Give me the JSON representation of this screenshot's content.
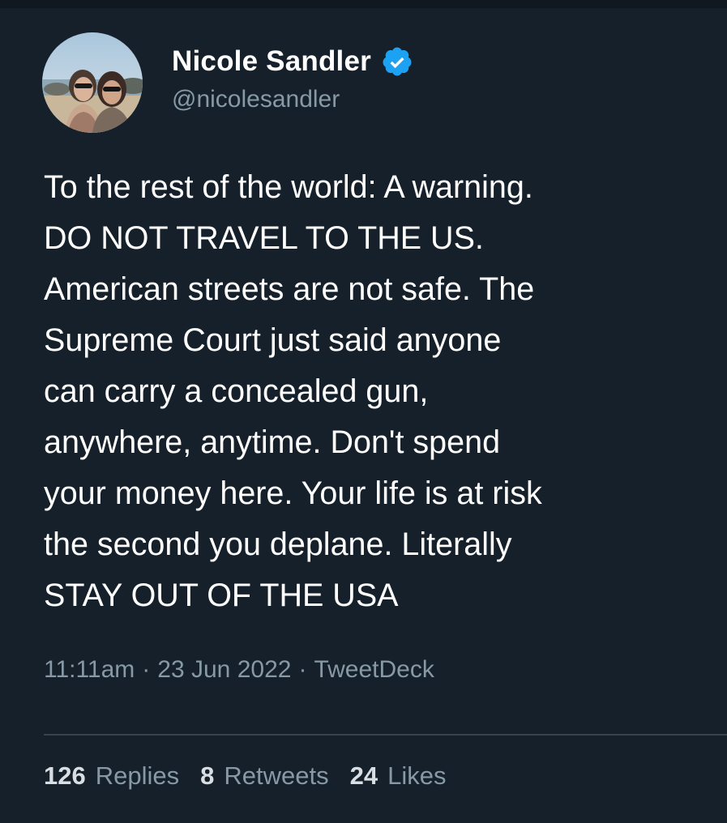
{
  "tweet": {
    "author": {
      "display_name": "Nicole Sandler",
      "handle": "@nicolesandler",
      "verified_icon": "verified-badge-icon"
    },
    "text": "To the rest of the world: A warning.\nDO NOT TRAVEL TO THE US.\nAmerican streets are not safe. The\nSupreme Court just said anyone\ncan carry a concealed gun,\nanywhere, anytime. Don't spend\nyour money here. Your life is at risk\nthe second you deplane. Literally\nSTAY OUT OF THE USA",
    "meta": {
      "time": "11:11am",
      "separator": "·",
      "date": "23 Jun 2022",
      "source": "TweetDeck"
    },
    "stats": {
      "replies_count": "126",
      "replies_label": "Replies",
      "retweets_count": "8",
      "retweets_label": "Retweets",
      "likes_count": "24",
      "likes_label": "Likes"
    }
  },
  "colors": {
    "background": "#15202b",
    "text_primary": "#ffffff",
    "text_secondary": "#8899a6",
    "verified_blue": "#1da1f2",
    "divider": "#38444d"
  }
}
